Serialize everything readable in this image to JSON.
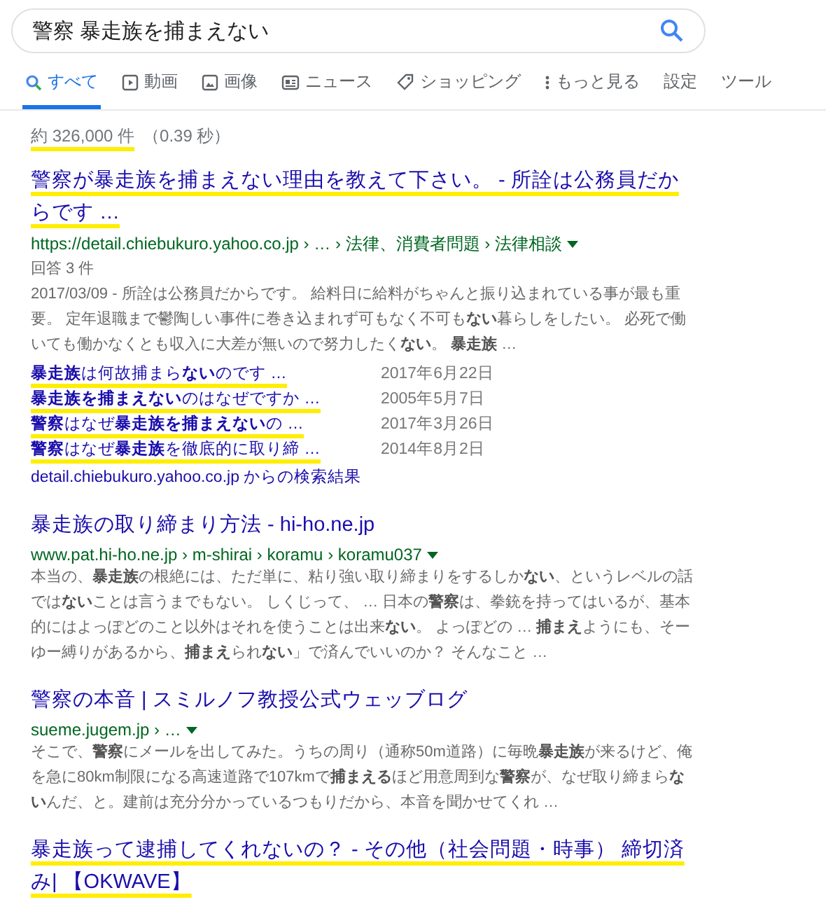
{
  "search": {
    "query": "警察 暴走族を捕まえない"
  },
  "tabs": [
    {
      "label": "すべて",
      "kind": "all",
      "selected": true
    },
    {
      "label": "動画",
      "kind": "video",
      "selected": false
    },
    {
      "label": "画像",
      "kind": "image",
      "selected": false
    },
    {
      "label": "ニュース",
      "kind": "news",
      "selected": false
    },
    {
      "label": "ショッピング",
      "kind": "shopping",
      "selected": false
    },
    {
      "label": "もっと見る",
      "kind": "more",
      "selected": false
    },
    {
      "label": "設定",
      "kind": "plain",
      "selected": false
    },
    {
      "label": "ツール",
      "kind": "plain",
      "selected": false
    }
  ],
  "stats": {
    "count": "約 326,000 件",
    "time": "（0.39 秒）",
    "underlined": true
  },
  "results": [
    {
      "title": "警察が暴走族を捕まえない理由を教えて下さい。 - 所詮は公務員だからです …",
      "underlined": true,
      "url": "https://detail.chiebukuro.yahoo.co.jp › … › 法律、消費者問題 › 法律相談",
      "meta": "回答 3 件",
      "snippet": "2017/03/09 - 所詮は公務員だからです。 給料日に給料がちゃんと振り込まれている事が最も重要。 定年退職まで鬱陶しい事件に巻き込まれず可もなく不可も**ない**暮らしをしたい。 必死で働いても働かなくとも収入に大差が無いので努力したく**ない**。 **暴走族** …",
      "sitelinks": [
        {
          "title": "**暴走族**は何故捕まら**ない**のです …",
          "date": "2017年6月22日",
          "underlined": true
        },
        {
          "title": "**暴走族を捕まえない**のはなぜですか …",
          "date": "2005年5月7日",
          "underlined": true
        },
        {
          "title": "**警察**はなぜ**暴走族を捕まえない**の …",
          "date": "2017年3月26日",
          "underlined": true
        },
        {
          "title": "**警察**はなぜ**暴走族**を徹底的に取り締 …",
          "date": "2014年8月2日",
          "underlined": true
        }
      ],
      "more": "detail.chiebukuro.yahoo.co.jp からの検索結果"
    },
    {
      "title": "暴走族の取り締まり方法 - hi-ho.ne.jp",
      "underlined": false,
      "url": "www.pat.hi-ho.ne.jp › m-shirai › koramu › koramu037",
      "snippet": "本当の、**暴走族**の根絶には、ただ単に、粘り強い取り締まりをするしか**ない**、というレベルの話では**ない**ことは言うまでもない。 しくじって、 … 日本の**警察**は、拳銃を持ってはいるが、基本的にはよっぽどのこと以外はそれを使うことは出来**ない**。 よっぽどの … **捕まえ**ようにも、そーゆー縛りがあるから、**捕まえ**られ**ない**」で済んでいいのか？ そんなこと …"
    },
    {
      "title": "警察の本音 | スミルノフ教授公式ウェッブログ",
      "underlined": false,
      "url": "sueme.jugem.jp › …",
      "snippet": "そこで、**警察**にメールを出してみた。うちの周り（通称50m道路）に毎晩**暴走族**が来るけど、俺を急に80km制限になる高速道路で107kmで**捕まえる**ほど用意周到な**警察**が、なぜ取り締まら**ない**んだ、と。建前は充分分かっているつもりだから、本音を聞かせてくれ …"
    },
    {
      "title": "暴走族って逮捕してくれないの？ - その他（社会問題・時事） 締切済み| 【OKWAVE】",
      "underlined": true
    }
  ]
}
